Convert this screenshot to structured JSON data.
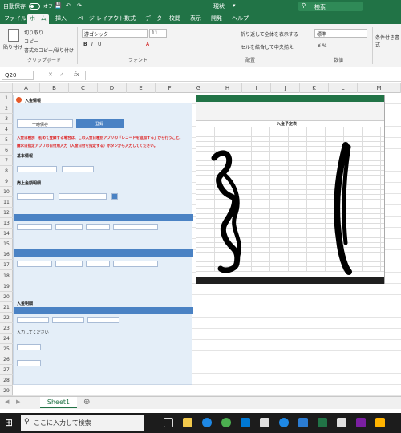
{
  "titlebar": {
    "autosave": "自動保存",
    "autosave_state": "オフ",
    "doc_name": "現状",
    "search": "検索"
  },
  "menu": [
    "ファイル",
    "ホーム",
    "挿入",
    "ページ レイアウト",
    "数式",
    "データ",
    "校閲",
    "表示",
    "開発",
    "ヘルプ"
  ],
  "ribbon": {
    "paste": "貼り付け",
    "cut": "切り取り",
    "copy": "コピー",
    "format_painter": "書式のコピー/貼り付け",
    "clipboard_group": "クリップボード",
    "font_name": "游ゴシック",
    "font_size": "11",
    "font_group": "フォント",
    "wrap_text": "折り返して全体を表示する",
    "merge_center": "セルを結合して中央揃え",
    "align_group": "配置",
    "number_format": "標準",
    "number_group": "数値",
    "cond_format": "条件付き書式"
  },
  "formula": {
    "namebox": "Q20",
    "fx": "fx",
    "value": ""
  },
  "columns": [
    "A",
    "B",
    "C",
    "D",
    "E",
    "F",
    "G",
    "H",
    "I",
    "J",
    "K",
    "L",
    "M"
  ],
  "rows": [
    "1",
    "2",
    "3",
    "4",
    "5",
    "6",
    "7",
    "8",
    "9",
    "10",
    "11",
    "12",
    "13",
    "14",
    "15",
    "16",
    "17",
    "18",
    "19",
    "20",
    "21",
    "22",
    "23",
    "24",
    "25",
    "26",
    "27",
    "28",
    "29"
  ],
  "sheet": {
    "tab": "Sheet1"
  },
  "left_image": {
    "title": "入金情報",
    "btn1": "一時保存",
    "btn2": "登録",
    "warn1": "入金日種別　初めて登録する場合は、この入金日種別アプリの「レコードを追加する」から行うこと。",
    "warn2": "請求日指定アプリの日付用入力（入金日付を指定する）ボタンから入力してください。",
    "basic": "基本情報",
    "total": "売上金額明細",
    "section1": "入金明細",
    "section2": "入金明細明細",
    "note": "入力してください"
  },
  "right_image": {
    "title": "入金予定表"
  },
  "taskbar": {
    "search": "ここに入力して検索"
  },
  "colors": {
    "excel_green": "#217346",
    "form_blue": "#4a82c4",
    "warning_red": "#dd2222"
  }
}
